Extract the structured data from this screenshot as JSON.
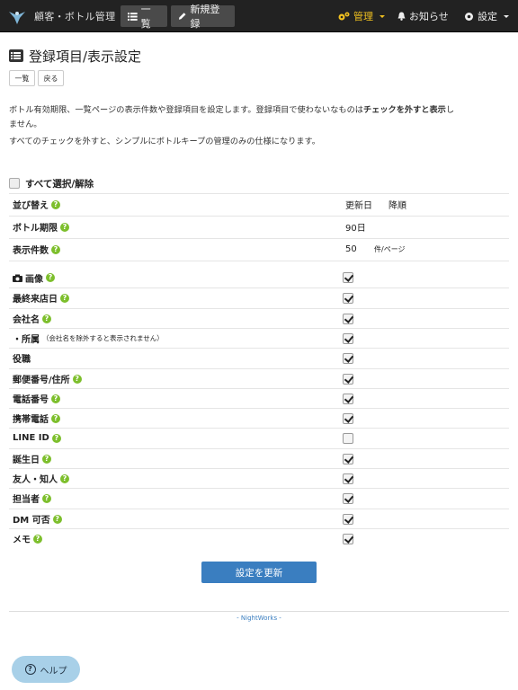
{
  "nav": {
    "brand": "顧客・ボトル管理",
    "list_button": "一覧",
    "new_button": "新規登録",
    "admin": "管理",
    "notice": "お知らせ",
    "settings": "設定"
  },
  "page": {
    "title": "登録項目/表示設定",
    "btn_list": "一覧",
    "btn_back": "戻る",
    "desc1_a": "ボトル有効期限、一覧ページの表示件数や登録項目を設定します。登録項目で使わないなものは",
    "desc1_b": "チェックを外すと表示",
    "desc1_c": "し",
    "desc1_d": "ません。",
    "desc2": "すべてのチェックを外すと、シンプルにボトルキープの管理のみの仕様になります。",
    "select_all": "すべて選択/解除"
  },
  "settings": {
    "sort_label": "並び替え",
    "sort_field": "更新日",
    "sort_order": "降順",
    "expire_label": "ボトル期限",
    "expire_value": "90日",
    "count_label": "表示件数",
    "count_value": "50",
    "count_unit": "件/ページ"
  },
  "fields": [
    {
      "label": "画像",
      "checked": true,
      "icon": "camera-icon"
    },
    {
      "label": "最終来店日",
      "checked": true
    },
    {
      "label": "会社名",
      "checked": true
    },
    {
      "label": "・所属",
      "note": "（会社名を除外すると表示されません）",
      "checked": true
    },
    {
      "label": "役職",
      "checked": true
    },
    {
      "label": "郵便番号/住所",
      "checked": true
    },
    {
      "label": "電話番号",
      "checked": true
    },
    {
      "label": "携帯電話",
      "checked": true
    },
    {
      "label": "LINE ID",
      "checked": false
    },
    {
      "label": "誕生日",
      "checked": true
    },
    {
      "label": "友人・知人",
      "checked": true
    },
    {
      "label": "担当者",
      "checked": true
    },
    {
      "label": "DM 可否",
      "checked": true
    },
    {
      "label": "メモ",
      "checked": true
    }
  ],
  "submit": "設定を更新",
  "footer": "- NightWorks -",
  "help_button": "ヘルプ",
  "colors": {
    "navbar": "#222222",
    "accent": "#3a7ec0",
    "help_badge": "#7dbf2c",
    "admin": "#f0c020"
  }
}
